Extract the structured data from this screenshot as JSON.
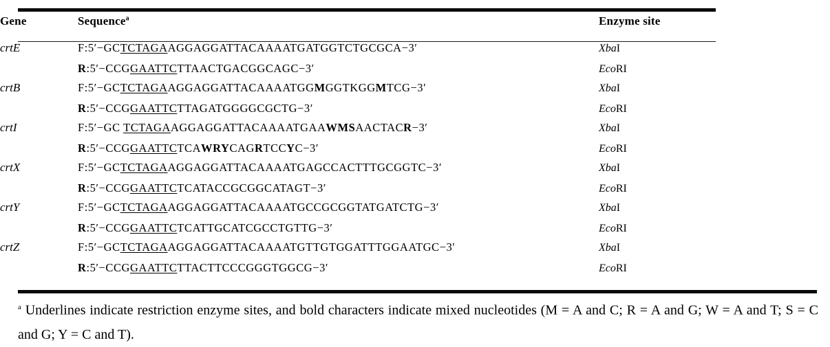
{
  "table": {
    "columns": {
      "gene": "Gene",
      "sequence": "Sequence",
      "sequence_footnote_mark": "a",
      "enzyme_site": "Enzyme site"
    },
    "rows": [
      {
        "gene": "crtE",
        "primers": [
          {
            "direction": "F",
            "text": "F:5′−GCTCTAGAAGGAGGATTACAAAATGATGGTCTGCGCA−3′",
            "enzyme_italic": "Xba",
            "enzyme_roman": "I"
          },
          {
            "direction": "R",
            "text": "R:5′−CCGGAATTCTTAACTGACGGCAGC−3′",
            "enzyme_italic": "Eco",
            "enzyme_roman": "RI"
          }
        ]
      },
      {
        "gene": "crtB",
        "primers": [
          {
            "direction": "F",
            "text": "F:5′−GCTCTAGAAGGAGGATTACAAAATGGMGGTKGGMTCG−3′",
            "enzyme_italic": "Xba",
            "enzyme_roman": "I"
          },
          {
            "direction": "R",
            "text": "R:5′−CCGGAATTCTTAGATGGGGCGCTG−3′",
            "enzyme_italic": "Eco",
            "enzyme_roman": "RI"
          }
        ]
      },
      {
        "gene": "crtI",
        "primers": [
          {
            "direction": "F",
            "text": "F:5′−GC TCTAGAAGGAGGATTACAAAATGAAWMSAACTACR−3′",
            "enzyme_italic": "Xba",
            "enzyme_roman": "I"
          },
          {
            "direction": "R",
            "text": "R:5′−CCGGAATTCTCAWRYCAGRTCCYC−3′",
            "enzyme_italic": "Eco",
            "enzyme_roman": "RI"
          }
        ]
      },
      {
        "gene": "crtX",
        "primers": [
          {
            "direction": "F",
            "text": "F:5′−GCTCTAGAAGGAGGATTACAAAATGAGCCACTTTGCGGTC−3′",
            "enzyme_italic": "Xba",
            "enzyme_roman": "I"
          },
          {
            "direction": "R",
            "text": "R:5′−CCGGAATTCTCATACCGCGGCATAGT−3′",
            "enzyme_italic": "Eco",
            "enzyme_roman": "RI"
          }
        ]
      },
      {
        "gene": "crtY",
        "primers": [
          {
            "direction": "F",
            "text": "F:5′−GCTCTAGAAGGAGGATTACAAAATGCCGCGGTATGATCTG−3′",
            "enzyme_italic": "Xba",
            "enzyme_roman": "I"
          },
          {
            "direction": "R",
            "text": "R:5′−CCGGAATTCTCATTGCATCGCCTGTTG−3′",
            "enzyme_italic": "Eco",
            "enzyme_roman": "RI"
          }
        ]
      },
      {
        "gene": "crtZ",
        "primers": [
          {
            "direction": "F",
            "text": "F:5′−GCTCTAGAAGGAGGATTACAAAATGTTGTGGATTTGGAATGC−3′",
            "enzyme_italic": "Xba",
            "enzyme_roman": "I"
          },
          {
            "direction": "R",
            "text": "R:5′−CCGGAATTCTTACTTCCCGGGTGGCG−3′",
            "enzyme_italic": "Eco",
            "enzyme_roman": "RI"
          }
        ]
      }
    ]
  },
  "footnote": {
    "mark": "a",
    "text": "Underlines indicate restriction enzyme sites, and bold characters indicate mixed nucleotides (M = A and C; R = A and G; W = A and T; S = C and G; Y = C and T)."
  },
  "colors": {
    "rule": "#0a0a0a",
    "thin_rule": "#1b1b1b",
    "text": "#000000",
    "background": "#ffffff"
  }
}
